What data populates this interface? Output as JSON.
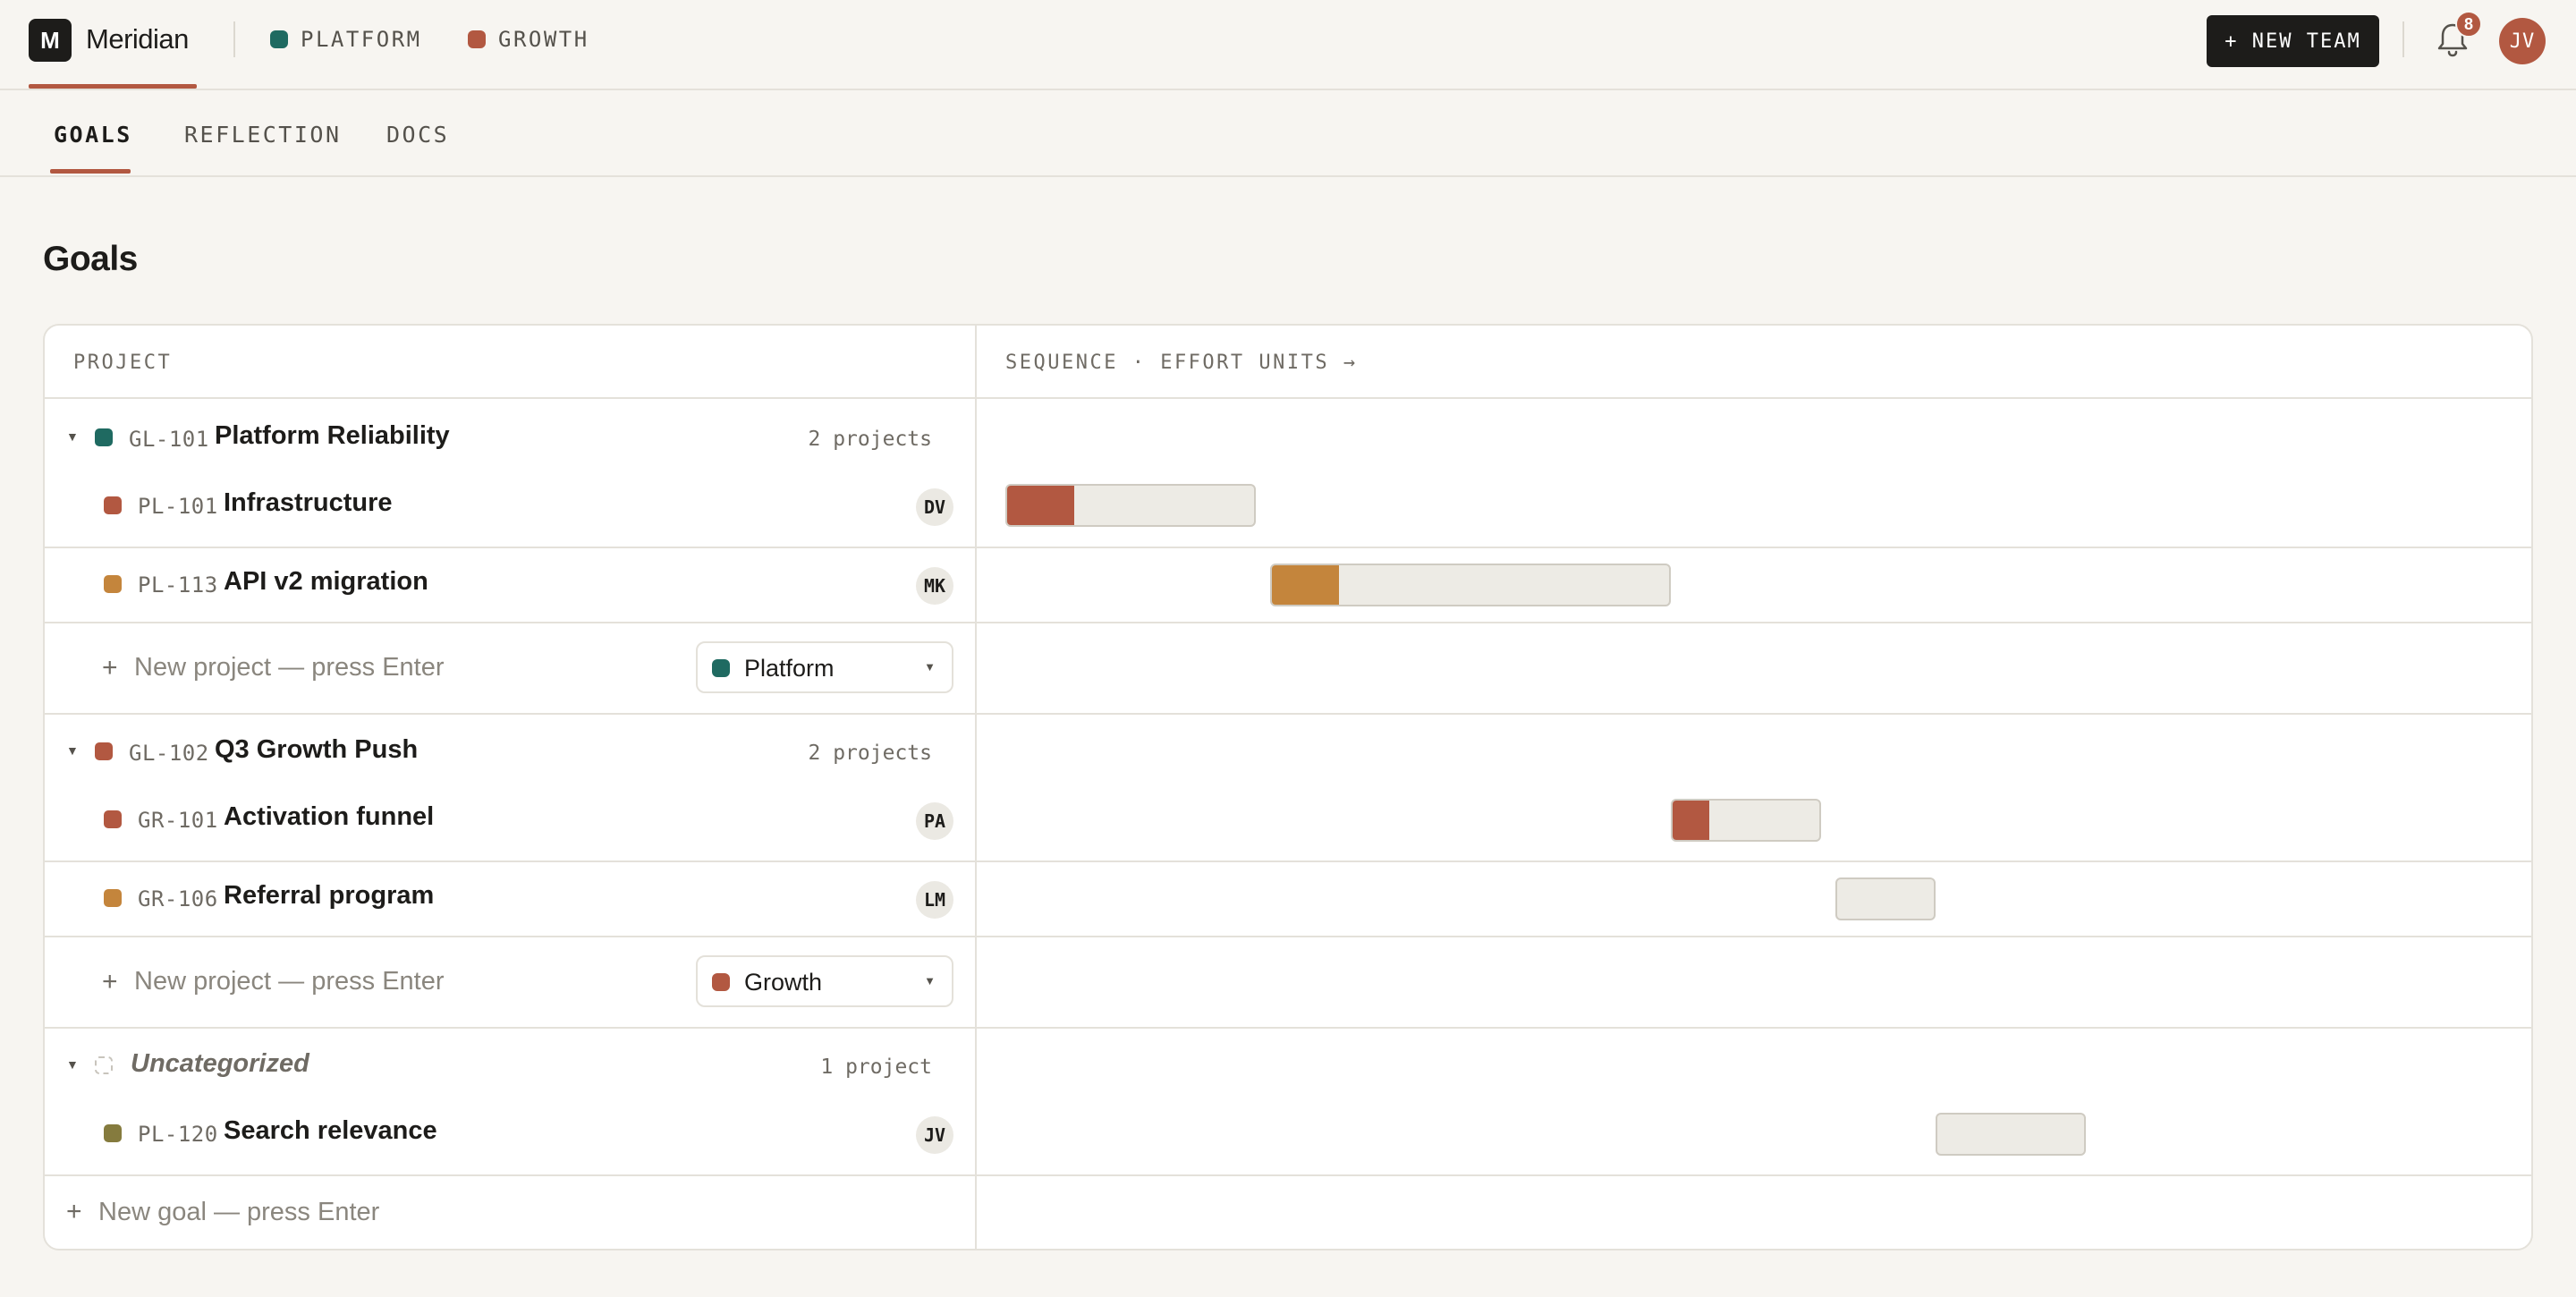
{
  "app": {
    "logo_letter": "M",
    "name": "Meridian",
    "teams": [
      {
        "label": "PLATFORM",
        "color": "#1f6a61"
      },
      {
        "label": "GROWTH",
        "color": "#b25841"
      }
    ],
    "new_team_label": "+ NEW TEAM",
    "notification_count": "8",
    "user_initials": "JV"
  },
  "tabs": [
    {
      "label": "GOALS",
      "active": true
    },
    {
      "label": "REFLECTION",
      "active": false
    },
    {
      "label": "DOCS",
      "active": false
    }
  ],
  "page_title": "Goals",
  "table": {
    "col_project": "PROJECT",
    "col_sequence": "SEQUENCE · EFFORT UNITS →",
    "goals": [
      {
        "id": "GL-101",
        "title": "Platform Reliability",
        "count": "2 projects",
        "color": "#1f6a61",
        "projects": [
          {
            "id": "PL-101",
            "title": "Infrastructure",
            "owner": "DV",
            "color": "#b25841",
            "progress": 0.27,
            "bar_color": "#b25841"
          },
          {
            "id": "PL-113",
            "title": "API v2 migration",
            "owner": "MK",
            "color": "#c4853c",
            "progress": 0.17,
            "bar_color": "#c4853c"
          }
        ],
        "new_project_placeholder": "New project — press Enter",
        "team_select": "Platform",
        "team_select_color": "#1f6a61"
      },
      {
        "id": "GL-102",
        "title": "Q3 Growth Push",
        "count": "2 projects",
        "color": "#b25841",
        "projects": [
          {
            "id": "GR-101",
            "title": "Activation funnel",
            "owner": "PA",
            "color": "#b25841",
            "progress": 0.25,
            "bar_color": "#b25841"
          },
          {
            "id": "GR-106",
            "title": "Referral program",
            "owner": "LM",
            "color": "#c4853c",
            "progress": 0,
            "bar_color": "#c4853c"
          }
        ],
        "new_project_placeholder": "New project — press Enter",
        "team_select": "Growth",
        "team_select_color": "#b25841"
      },
      {
        "id": "",
        "title": "Uncategorized",
        "count": "1 project",
        "projects": [
          {
            "id": "PL-120",
            "title": "Search relevance",
            "owner": "JV",
            "color": "#857b3e",
            "progress": 0,
            "bar_color": "#857b3e"
          }
        ]
      }
    ],
    "new_goal_placeholder": "New goal — press Enter"
  }
}
